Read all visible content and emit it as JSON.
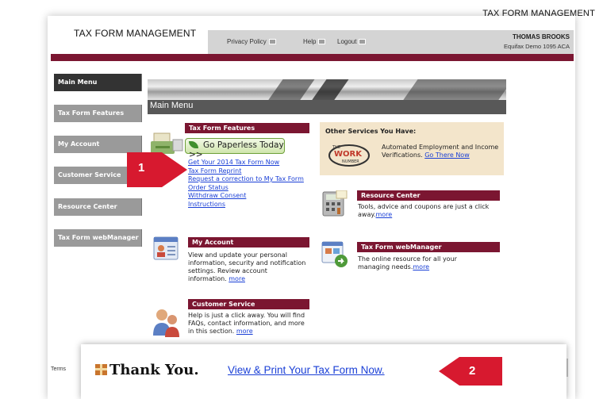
{
  "header": {
    "top_title": "TAX FORM MANAGEMENT",
    "app_title": "TAX FORM MANAGEMENT",
    "nav": [
      {
        "label": "Privacy Policy"
      },
      {
        "label": "Help"
      },
      {
        "label": "Logout"
      }
    ],
    "user_name": "THOMAS BROOKS",
    "user_org": "Equifax Demo 1095 ACA"
  },
  "sidebar": {
    "items": [
      {
        "label": "Main Menu"
      },
      {
        "label": "Tax Form Features"
      },
      {
        "label": "My Account"
      },
      {
        "label": "Customer Service"
      },
      {
        "label": "Resource Center"
      },
      {
        "label": "Tax Form webManager"
      }
    ]
  },
  "main": {
    "section_title": "Main Menu",
    "tax_form_features": {
      "title": "Tax Form Features",
      "paperless_button": "Go Paperless Today >>",
      "links": [
        "Get Your 2014 Tax Form Now",
        "Tax Form Reprint",
        "Request a correction to My Tax Form",
        "Order Status",
        "Withdraw Consent",
        "Instructions"
      ]
    },
    "other_services": {
      "title": "Other Services You Have:",
      "logo_text_top": "THE",
      "logo_text_main": "WORK",
      "logo_text_bottom": "NUMBER",
      "text": "Automated Employment and Income Verifications.",
      "link": "Go There Now"
    },
    "resource_center": {
      "title": "Resource Center",
      "text": "Tools, advice and coupons are just a click away.",
      "link": "more"
    },
    "my_account": {
      "title": "My Account",
      "text": "View and update your personal information, security and notification settings. Review account information.",
      "link": "more"
    },
    "webmanager": {
      "title": "Tax Form webManager",
      "text": "The online resource for all your managing needs.",
      "link": "more"
    },
    "customer_service": {
      "title": "Customer Service",
      "text": "Help is just a click away. You will find FAQs, contact information, and more in this section.",
      "link": "more"
    }
  },
  "footer": {
    "terms": "Terms"
  },
  "callouts": {
    "step1": "1",
    "step2": "2"
  },
  "thank_you": {
    "text": "Thank You.",
    "link": "View & Print Your Tax Form Now."
  },
  "colors": {
    "brand_maroon": "#7b1631",
    "callout_red": "#d7192f",
    "link_blue": "#1a3fd6",
    "services_bg": "#f3e5cb"
  }
}
